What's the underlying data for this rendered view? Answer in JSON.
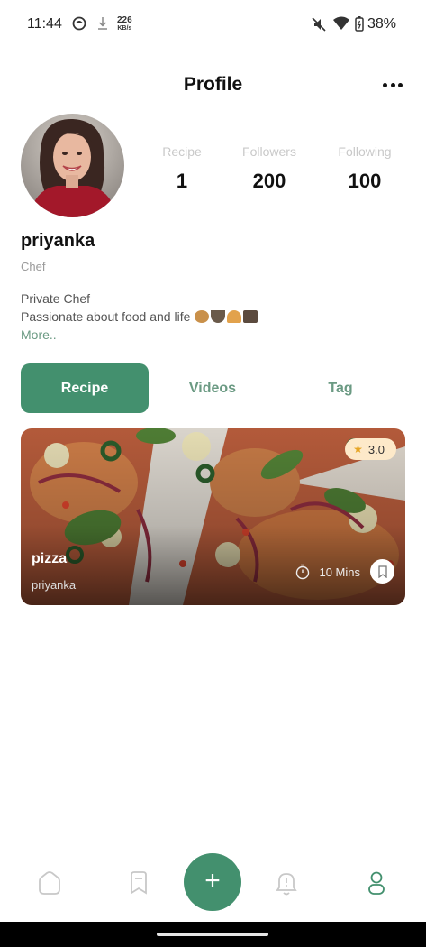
{
  "status_bar": {
    "time": "11:44",
    "net_speed_value": "226",
    "net_speed_unit": "KB/s",
    "battery": "38%"
  },
  "header": {
    "title": "Profile"
  },
  "profile": {
    "username": "priyanka",
    "role": "Chef",
    "bio_line1": "Private Chef",
    "bio_line2": "Passionate about food and life",
    "more_link": "More..",
    "stats": [
      {
        "label": "Recipe",
        "value": "1"
      },
      {
        "label": "Followers",
        "value": "200"
      },
      {
        "label": "Following",
        "value": "100"
      }
    ]
  },
  "tabs": [
    {
      "label": "Recipe",
      "active": true
    },
    {
      "label": "Videos",
      "active": false
    },
    {
      "label": "Tag",
      "active": false
    }
  ],
  "recipes": [
    {
      "title": "pizza",
      "author": "priyanka",
      "rating": "3.0",
      "duration": "10 Mins"
    }
  ],
  "bottom_nav": {
    "items": [
      "home-icon",
      "bookmark-icon",
      "add-icon",
      "bell-icon",
      "profile-icon"
    ],
    "fab_label": "+"
  },
  "colors": {
    "accent": "#43906e",
    "accent_text": "#6b9a83",
    "rating_bg": "#fde9c9"
  }
}
